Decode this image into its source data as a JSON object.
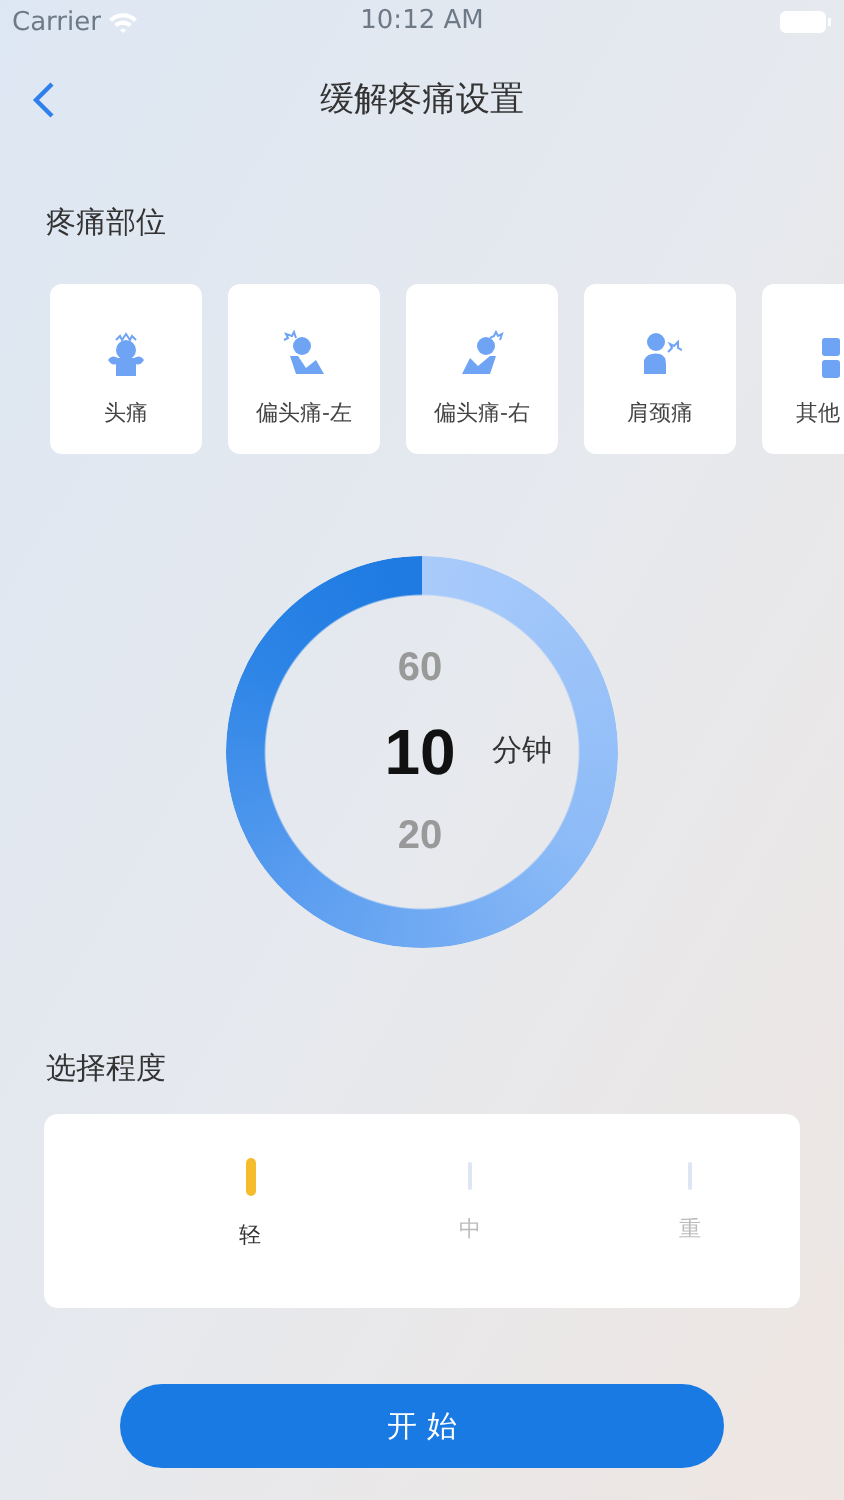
{
  "status_bar": {
    "carrier": "Carrier",
    "time": "10:12 AM"
  },
  "nav": {
    "title": "缓解疼痛设置"
  },
  "pain_area": {
    "heading": "疼痛部位",
    "items": [
      {
        "label": "头痛",
        "kind": "head"
      },
      {
        "label": "偏头痛-左",
        "kind": "left"
      },
      {
        "label": "偏头痛-右",
        "kind": "right"
      },
      {
        "label": "肩颈痛",
        "kind": "neck"
      },
      {
        "label": "其他",
        "kind": "grid"
      }
    ]
  },
  "timer": {
    "options": [
      {
        "value": "60",
        "selected": false
      },
      {
        "value": "10",
        "selected": true
      },
      {
        "value": "20",
        "selected": false
      }
    ],
    "unit": "分钟"
  },
  "intensity": {
    "heading": "选择程度",
    "levels": [
      {
        "label": "轻",
        "selected": true
      },
      {
        "label": "中",
        "selected": false
      },
      {
        "label": "重",
        "selected": false
      }
    ]
  },
  "start_button": "开 始"
}
